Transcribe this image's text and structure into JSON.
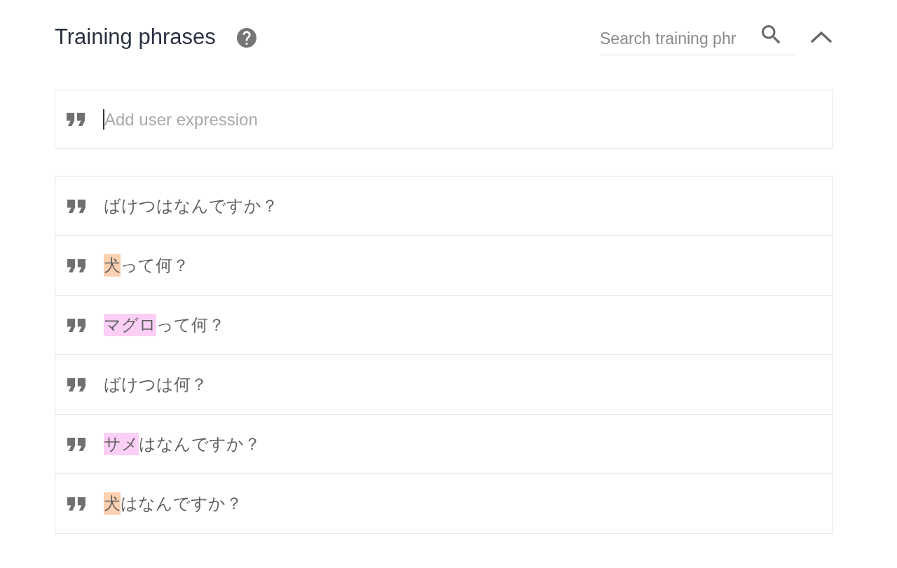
{
  "section": {
    "title": "Training phrases",
    "expanded": true,
    "search": {
      "placeholder": "Search training phr"
    }
  },
  "add_expression": {
    "placeholder": "Add user expression",
    "focused": true
  },
  "phrases": [
    {
      "segments": [
        {
          "text": "ばけつはなんですか？"
        }
      ]
    },
    {
      "segments": [
        {
          "text": "犬",
          "color": "#fdd0b0"
        },
        {
          "text": "って何？"
        }
      ]
    },
    {
      "segments": [
        {
          "text": "マグロ",
          "color": "#fccff6"
        },
        {
          "text": "って何？"
        }
      ]
    },
    {
      "segments": [
        {
          "text": "ばけつは何？"
        }
      ]
    },
    {
      "segments": [
        {
          "text": "サメ",
          "color": "#fccff6"
        },
        {
          "text": "はなんですか？"
        }
      ]
    },
    {
      "segments": [
        {
          "text": "犬",
          "color": "#fdd0b0"
        },
        {
          "text": "はなんですか？"
        }
      ]
    }
  ]
}
